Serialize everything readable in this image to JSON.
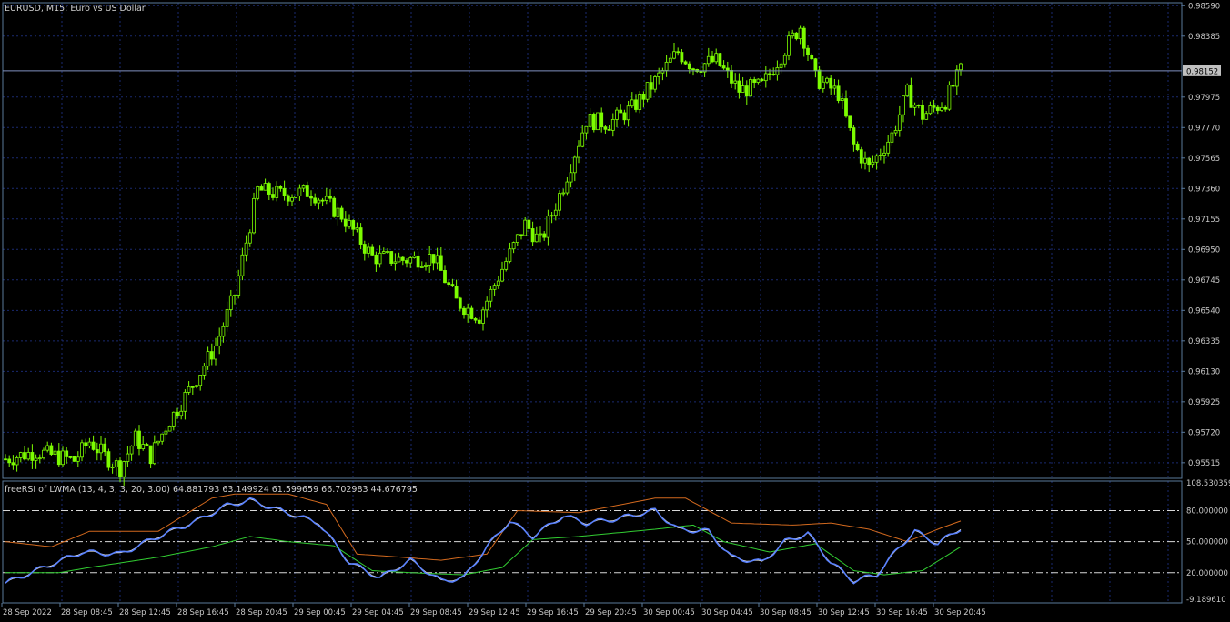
{
  "window": {
    "symbol_title": "EURUSD, M15:  Euro vs US Dollar"
  },
  "indicator": {
    "title": "freeRSI of LWMA (13, 4, 3, 3, 20, 3.00) 64.881793 63.149924 61.599659 66.702983 44.676795"
  },
  "colors": {
    "background": "#000000",
    "grid": "#1a2a70",
    "frame": "#5a7a9a",
    "candles": "#7cfc00",
    "bid_line": "#8090c0",
    "label_box": "#c0c0c0",
    "rsi_main": "#5a82ff",
    "rsi_signal": "#e0e0e0",
    "upper_band": "#d2691e",
    "lower_band": "#32cd32",
    "levels": "#d8d8d8"
  },
  "price_axis": {
    "ticks": [
      "0.98590",
      "0.98385",
      "0.97975",
      "0.97770",
      "0.97565",
      "0.97360",
      "0.97155",
      "0.96950",
      "0.96745",
      "0.96540",
      "0.96335",
      "0.96130",
      "0.95925",
      "0.95720",
      "0.95515"
    ],
    "tick_values": [
      0.9859,
      0.98385,
      0.97975,
      0.9777,
      0.97565,
      0.9736,
      0.97155,
      0.9695,
      0.96745,
      0.9654,
      0.96335,
      0.9613,
      0.95925,
      0.9572,
      0.95515
    ],
    "min": 0.9541,
    "max": 0.9861,
    "current_price": "0.98152",
    "current_value": 0.98152
  },
  "rsi_axis": {
    "labels": [
      "108.530359",
      "80.000000",
      "50.000000",
      "20.000000",
      "-9.189610"
    ],
    "max": 108.530359,
    "min": -9.18961,
    "levels": [
      80,
      50,
      20
    ]
  },
  "time_axis": {
    "labels": [
      "28 Sep 2022",
      "28 Sep 08:45",
      "28 Sep 12:45",
      "28 Sep 16:45",
      "28 Sep 20:45",
      "29 Sep 00:45",
      "29 Sep 04:45",
      "29 Sep 08:45",
      "29 Sep 12:45",
      "29 Sep 16:45",
      "29 Sep 20:45",
      "30 Sep 00:45",
      "30 Sep 04:45",
      "30 Sep 08:45",
      "30 Sep 12:45",
      "30 Sep 16:45",
      "30 Sep 20:45"
    ]
  },
  "chart_data": {
    "type": "candlestick",
    "symbol": "EURUSD",
    "timeframe": "M15",
    "anchors": {
      "price_path": [
        [
          0,
          0.9554
        ],
        [
          8,
          0.9559
        ],
        [
          18,
          0.9553
        ],
        [
          22,
          0.9566
        ],
        [
          26,
          0.9556
        ],
        [
          30,
          0.9548
        ],
        [
          34,
          0.9568
        ],
        [
          38,
          0.9556
        ],
        [
          42,
          0.9576
        ],
        [
          48,
          0.96
        ],
        [
          55,
          0.963
        ],
        [
          60,
          0.9665
        ],
        [
          66,
          0.9735
        ],
        [
          72,
          0.9732
        ],
        [
          80,
          0.9734
        ],
        [
          88,
          0.9718
        ],
        [
          96,
          0.969
        ],
        [
          104,
          0.9688
        ],
        [
          112,
          0.969
        ],
        [
          118,
          0.966
        ],
        [
          124,
          0.965
        ],
        [
          130,
          0.9682
        ],
        [
          136,
          0.9712
        ],
        [
          140,
          0.97
        ],
        [
          146,
          0.9738
        ],
        [
          152,
          0.9782
        ],
        [
          158,
          0.978
        ],
        [
          164,
          0.979
        ],
        [
          170,
          0.9808
        ],
        [
          176,
          0.9828
        ],
        [
          180,
          0.9818
        ],
        [
          186,
          0.9822
        ],
        [
          192,
          0.9802
        ],
        [
          198,
          0.9805
        ],
        [
          204,
          0.983
        ],
        [
          208,
          0.9845
        ],
        [
          212,
          0.981
        ],
        [
          218,
          0.98
        ],
        [
          222,
          0.9765
        ],
        [
          226,
          0.975
        ],
        [
          232,
          0.9772
        ],
        [
          236,
          0.98
        ],
        [
          240,
          0.9785
        ],
        [
          246,
          0.9795
        ],
        [
          250,
          0.9815
        ]
      ],
      "rsi": [
        [
          0,
          10
        ],
        [
          10,
          25
        ],
        [
          20,
          40
        ],
        [
          30,
          38
        ],
        [
          40,
          55
        ],
        [
          50,
          70
        ],
        [
          58,
          85
        ],
        [
          64,
          90
        ],
        [
          72,
          80
        ],
        [
          82,
          68
        ],
        [
          90,
          30
        ],
        [
          98,
          15
        ],
        [
          106,
          32
        ],
        [
          114,
          12
        ],
        [
          120,
          15
        ],
        [
          126,
          45
        ],
        [
          132,
          70
        ],
        [
          138,
          55
        ],
        [
          146,
          75
        ],
        [
          152,
          68
        ],
        [
          160,
          72
        ],
        [
          170,
          80
        ],
        [
          176,
          62
        ],
        [
          184,
          60
        ],
        [
          190,
          35
        ],
        [
          198,
          30
        ],
        [
          204,
          50
        ],
        [
          210,
          58
        ],
        [
          216,
          30
        ],
        [
          222,
          12
        ],
        [
          228,
          18
        ],
        [
          234,
          45
        ],
        [
          238,
          60
        ],
        [
          244,
          48
        ],
        [
          250,
          63
        ]
      ],
      "upper_band": [
        [
          0,
          50
        ],
        [
          12,
          45
        ],
        [
          22,
          60
        ],
        [
          40,
          60
        ],
        [
          54,
          92
        ],
        [
          60,
          96
        ],
        [
          74,
          96
        ],
        [
          84,
          86
        ],
        [
          92,
          38
        ],
        [
          100,
          36
        ],
        [
          114,
          32
        ],
        [
          126,
          38
        ],
        [
          134,
          80
        ],
        [
          150,
          78
        ],
        [
          170,
          92
        ],
        [
          178,
          92
        ],
        [
          190,
          68
        ],
        [
          206,
          66
        ],
        [
          216,
          68
        ],
        [
          226,
          62
        ],
        [
          236,
          50
        ],
        [
          244,
          62
        ],
        [
          250,
          70
        ]
      ],
      "lower_band": [
        [
          0,
          20
        ],
        [
          14,
          20
        ],
        [
          22,
          25
        ],
        [
          40,
          35
        ],
        [
          54,
          45
        ],
        [
          64,
          55
        ],
        [
          74,
          50
        ],
        [
          86,
          46
        ],
        [
          96,
          22
        ],
        [
          106,
          20
        ],
        [
          120,
          18
        ],
        [
          130,
          25
        ],
        [
          138,
          52
        ],
        [
          150,
          55
        ],
        [
          170,
          62
        ],
        [
          180,
          66
        ],
        [
          188,
          50
        ],
        [
          200,
          40
        ],
        [
          212,
          48
        ],
        [
          222,
          22
        ],
        [
          230,
          18
        ],
        [
          240,
          22
        ],
        [
          250,
          45
        ]
      ]
    },
    "bars": 251
  }
}
